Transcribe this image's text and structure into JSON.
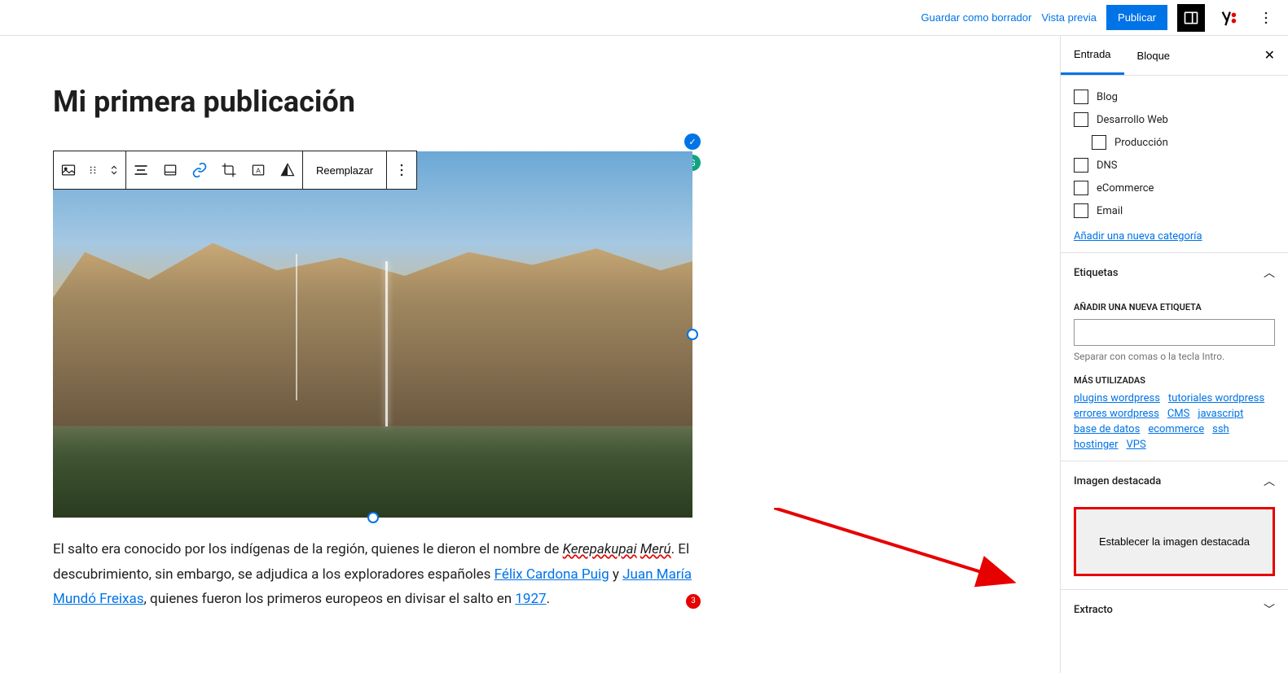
{
  "topbar": {
    "save_draft": "Guardar como borrador",
    "preview": "Vista previa",
    "publish": "Publicar"
  },
  "editor": {
    "title": "Mi primera publicación",
    "toolbar": {
      "replace": "Reemplazar"
    },
    "paragraph_parts": {
      "p1": "El salto era conocido por los indígenas de la región, quienes le dieron el nombre de ",
      "kerepakupai": "Kerepakupai",
      "space": " ",
      "meru": "Merú",
      "p2": ". El descubrimiento, sin embargo, se adjudica a los exploradores españoles ",
      "link1": "Félix Cardona Puig",
      "y": " y ",
      "link2": "Juan María Mundó Freixas",
      "p3": ", quienes fueron los primeros europeos en divisar el salto en ",
      "link3": "1927",
      "dot": "."
    },
    "badge_count": "3"
  },
  "sidebar": {
    "tabs": {
      "entry": "Entrada",
      "block": "Bloque"
    },
    "categories": {
      "items": [
        "Blog",
        "Desarrollo Web",
        "Producción",
        "DNS",
        "eCommerce",
        "Email"
      ],
      "add_new": "Añadir una nueva categoría"
    },
    "tags": {
      "title": "Etiquetas",
      "add_label": "AÑADIR UNA NUEVA ETIQUETA",
      "hint": "Separar con comas o la tecla Intro.",
      "most_used_label": "MÁS UTILIZADAS",
      "links": [
        "plugins wordpress",
        "tutoriales wordpress",
        "errores wordpress",
        "CMS",
        "javascript",
        "base de datos",
        "ecommerce",
        "ssh",
        "hostinger",
        "VPS"
      ]
    },
    "featured": {
      "title": "Imagen destacada",
      "button": "Establecer la imagen destacada"
    },
    "excerpt": {
      "title": "Extracto"
    }
  }
}
